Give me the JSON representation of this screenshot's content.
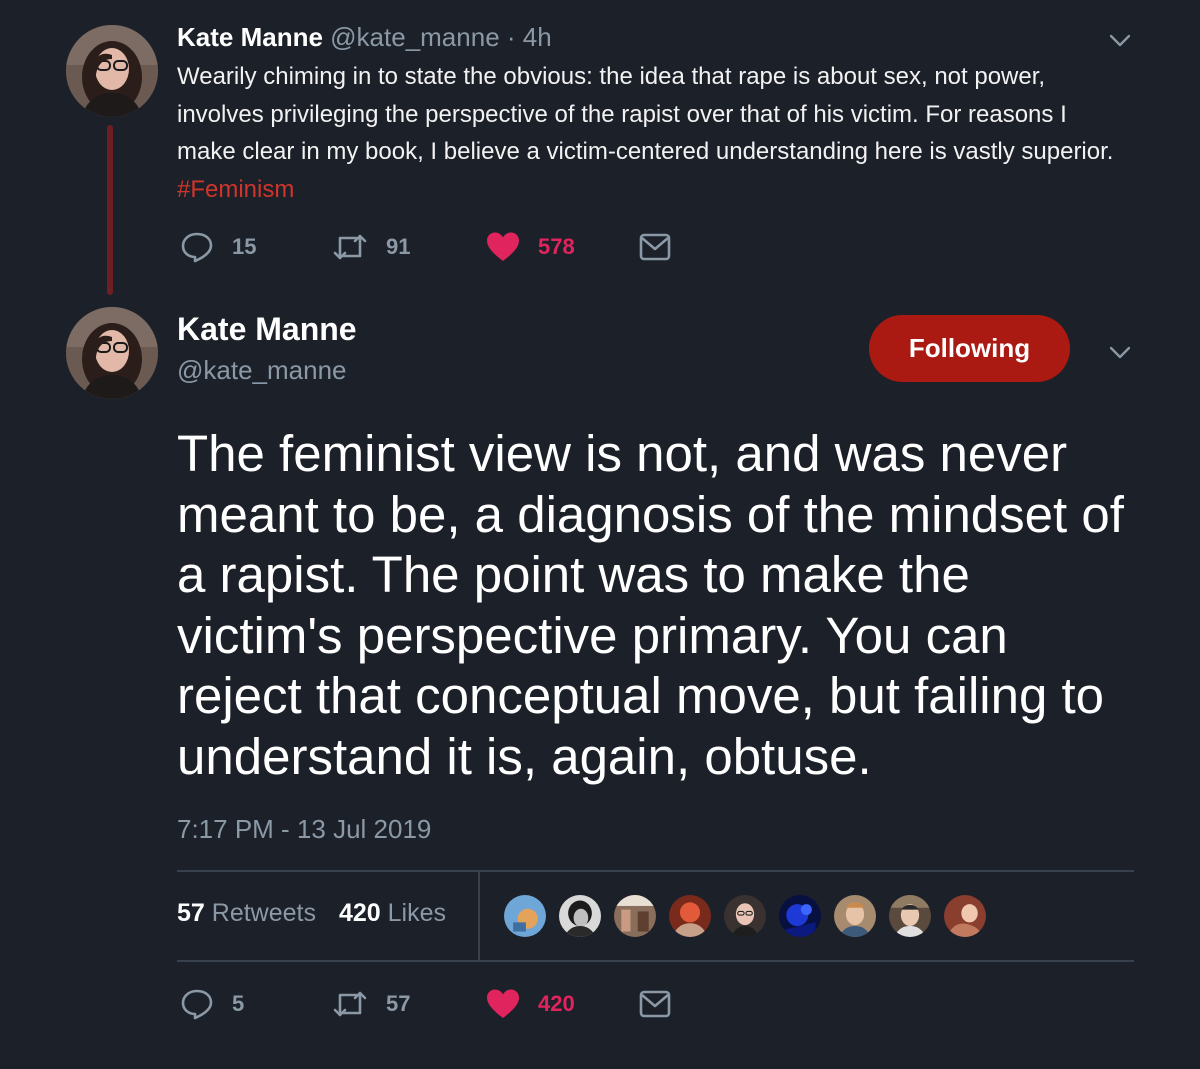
{
  "reply_tweet": {
    "author_name": "Kate Manne",
    "author_handle": "@kate_manne",
    "time_ago": "· 4h",
    "text": "Wearily chiming in to state the obvious: the idea that rape is about sex, not power, involves privileging the perspective of the rapist over that of his victim. For reasons I make clear in my book, I believe a victim-centered understanding here is vastly superior. ",
    "hashtag": "#Feminism",
    "actions": {
      "replies": "15",
      "retweets": "91",
      "likes": "578"
    }
  },
  "main_tweet": {
    "author_name": "Kate Manne",
    "author_handle": "@kate_manne",
    "follow_label": "Following",
    "text": "The feminist view is not, and was never meant to be, a diagnosis of the mindset of a rapist. The point was to make the victim's perspective primary. You can reject that conceptual move, but failing to understand it is, again, obtuse.",
    "timestamp": "7:17 PM - 13 Jul 2019",
    "stats": {
      "retweets_count": "57",
      "retweets_label": "Retweets",
      "likes_count": "420",
      "likes_label": "Likes"
    },
    "actions": {
      "replies": "5",
      "retweets": "57",
      "likes": "420"
    }
  },
  "icons": {
    "reply": "reply-icon",
    "retweet": "retweet-icon",
    "like": "heart-icon",
    "message": "message-icon",
    "menu": "chevron-down-icon"
  },
  "colors": {
    "background": "#1c2029",
    "follow_button": "#ab1a12",
    "hashtag": "#d0352b",
    "like": "#e0245e",
    "thread_line": "#6d1f23",
    "muted_text": "#8b98a5"
  }
}
